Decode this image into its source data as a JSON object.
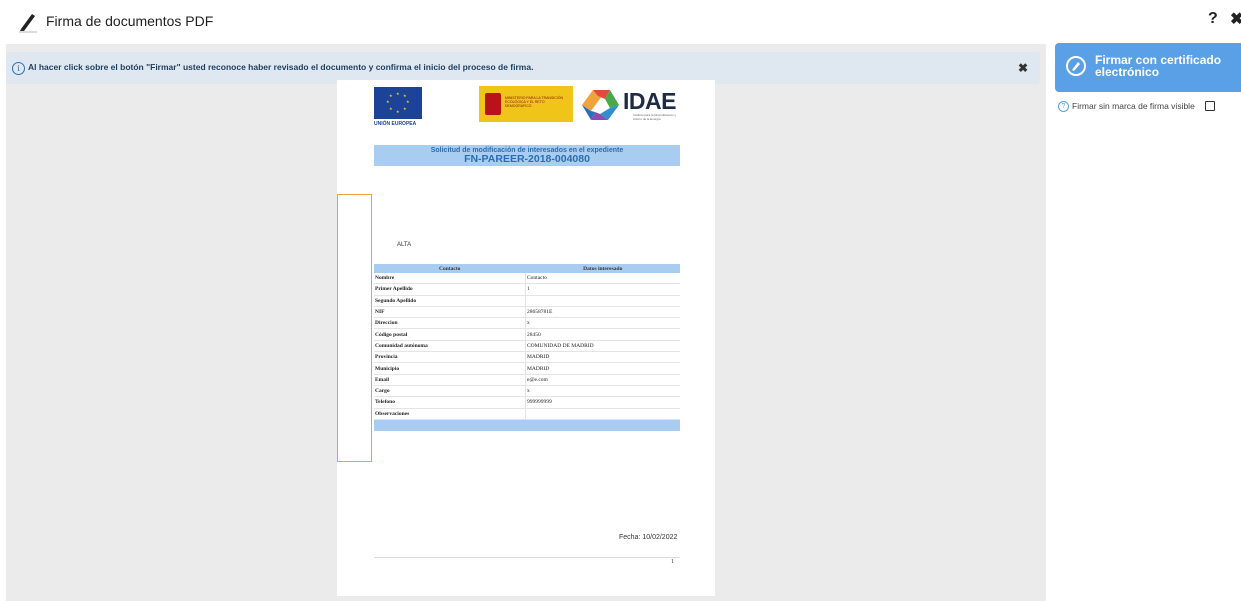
{
  "header": {
    "title": "Firma de documentos PDF",
    "help_glyph": "?",
    "close_glyph": "✖"
  },
  "notice": {
    "info_glyph": "i",
    "text": "Al hacer click sobre el botón \"Firmar\" usted reconoce haber revisado el documento y confirma el inicio del proceso de firma.",
    "close_glyph": "✖"
  },
  "document": {
    "eu_label": "UNIÓN EUROPEA",
    "gov_text": "MINISTERIO PARA LA TRANSICIÓN ECOLÓGICA Y EL RETO DEMOGRÁFICO",
    "idae_text": "IDAE",
    "idae_sub": "Instituto para la Diversificación y Ahorro de la Energía",
    "title_line1": "Solicitud de modificación de interesados en el expediente",
    "title_line2": "FN-PAREER-2018-004080",
    "alta": "ALTA",
    "table": {
      "headers": [
        "Contacto",
        "Datos interesado"
      ],
      "rows": [
        [
          "Nombre",
          "Contacto"
        ],
        [
          "Primer Apellido",
          "1"
        ],
        [
          "Segundo Apellido",
          ""
        ],
        [
          "NIF",
          "28658781E"
        ],
        [
          "Direccion",
          "x"
        ],
        [
          "Código postal",
          "28450"
        ],
        [
          "Comunidad autónoma",
          "COMUNIDAD DE MADRID"
        ],
        [
          "Provincia",
          "MADRID"
        ],
        [
          "Municipio",
          "MADRID"
        ],
        [
          "Email",
          "e@e.com"
        ],
        [
          "Cargo",
          "x"
        ],
        [
          "Telefono",
          "999999999"
        ],
        [
          "Observaciones",
          ""
        ]
      ]
    },
    "fecha": "Fecha: 10/02/2022",
    "page_number": "1"
  },
  "sidebar": {
    "sign_button_label": "Firmar con certificado electrónico",
    "option_help_glyph": "?",
    "option_label": "Firmar sin marca de firma visible",
    "option_checked": false
  },
  "colors": {
    "accent": "#5aa0e6",
    "table_header": "#a9cdf1",
    "signature_box": "#f0a23b",
    "notice_bg": "#dfe8f1"
  }
}
